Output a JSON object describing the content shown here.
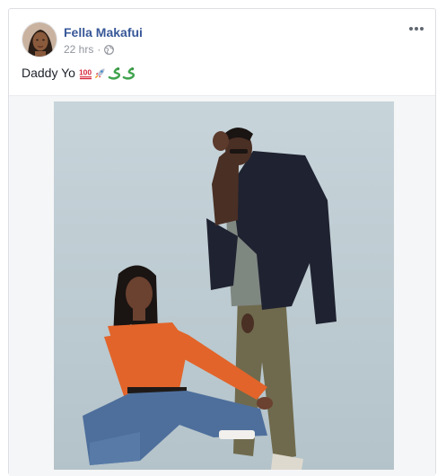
{
  "post": {
    "author": "Fella Makafui",
    "timestamp": "22 hrs",
    "privacy_icon": "globe-icon",
    "text": "Daddy Yo",
    "emojis": [
      "hundred-points-emoji",
      "rocket-emoji",
      "snake-emoji",
      "snake-emoji"
    ],
    "more_icon": "more-options-icon"
  },
  "colors": {
    "author_link": "#385898",
    "meta_text": "#90949c",
    "body_text": "#1d2129",
    "border": "#dddfe2",
    "photo_background": "#c9d6dc"
  }
}
